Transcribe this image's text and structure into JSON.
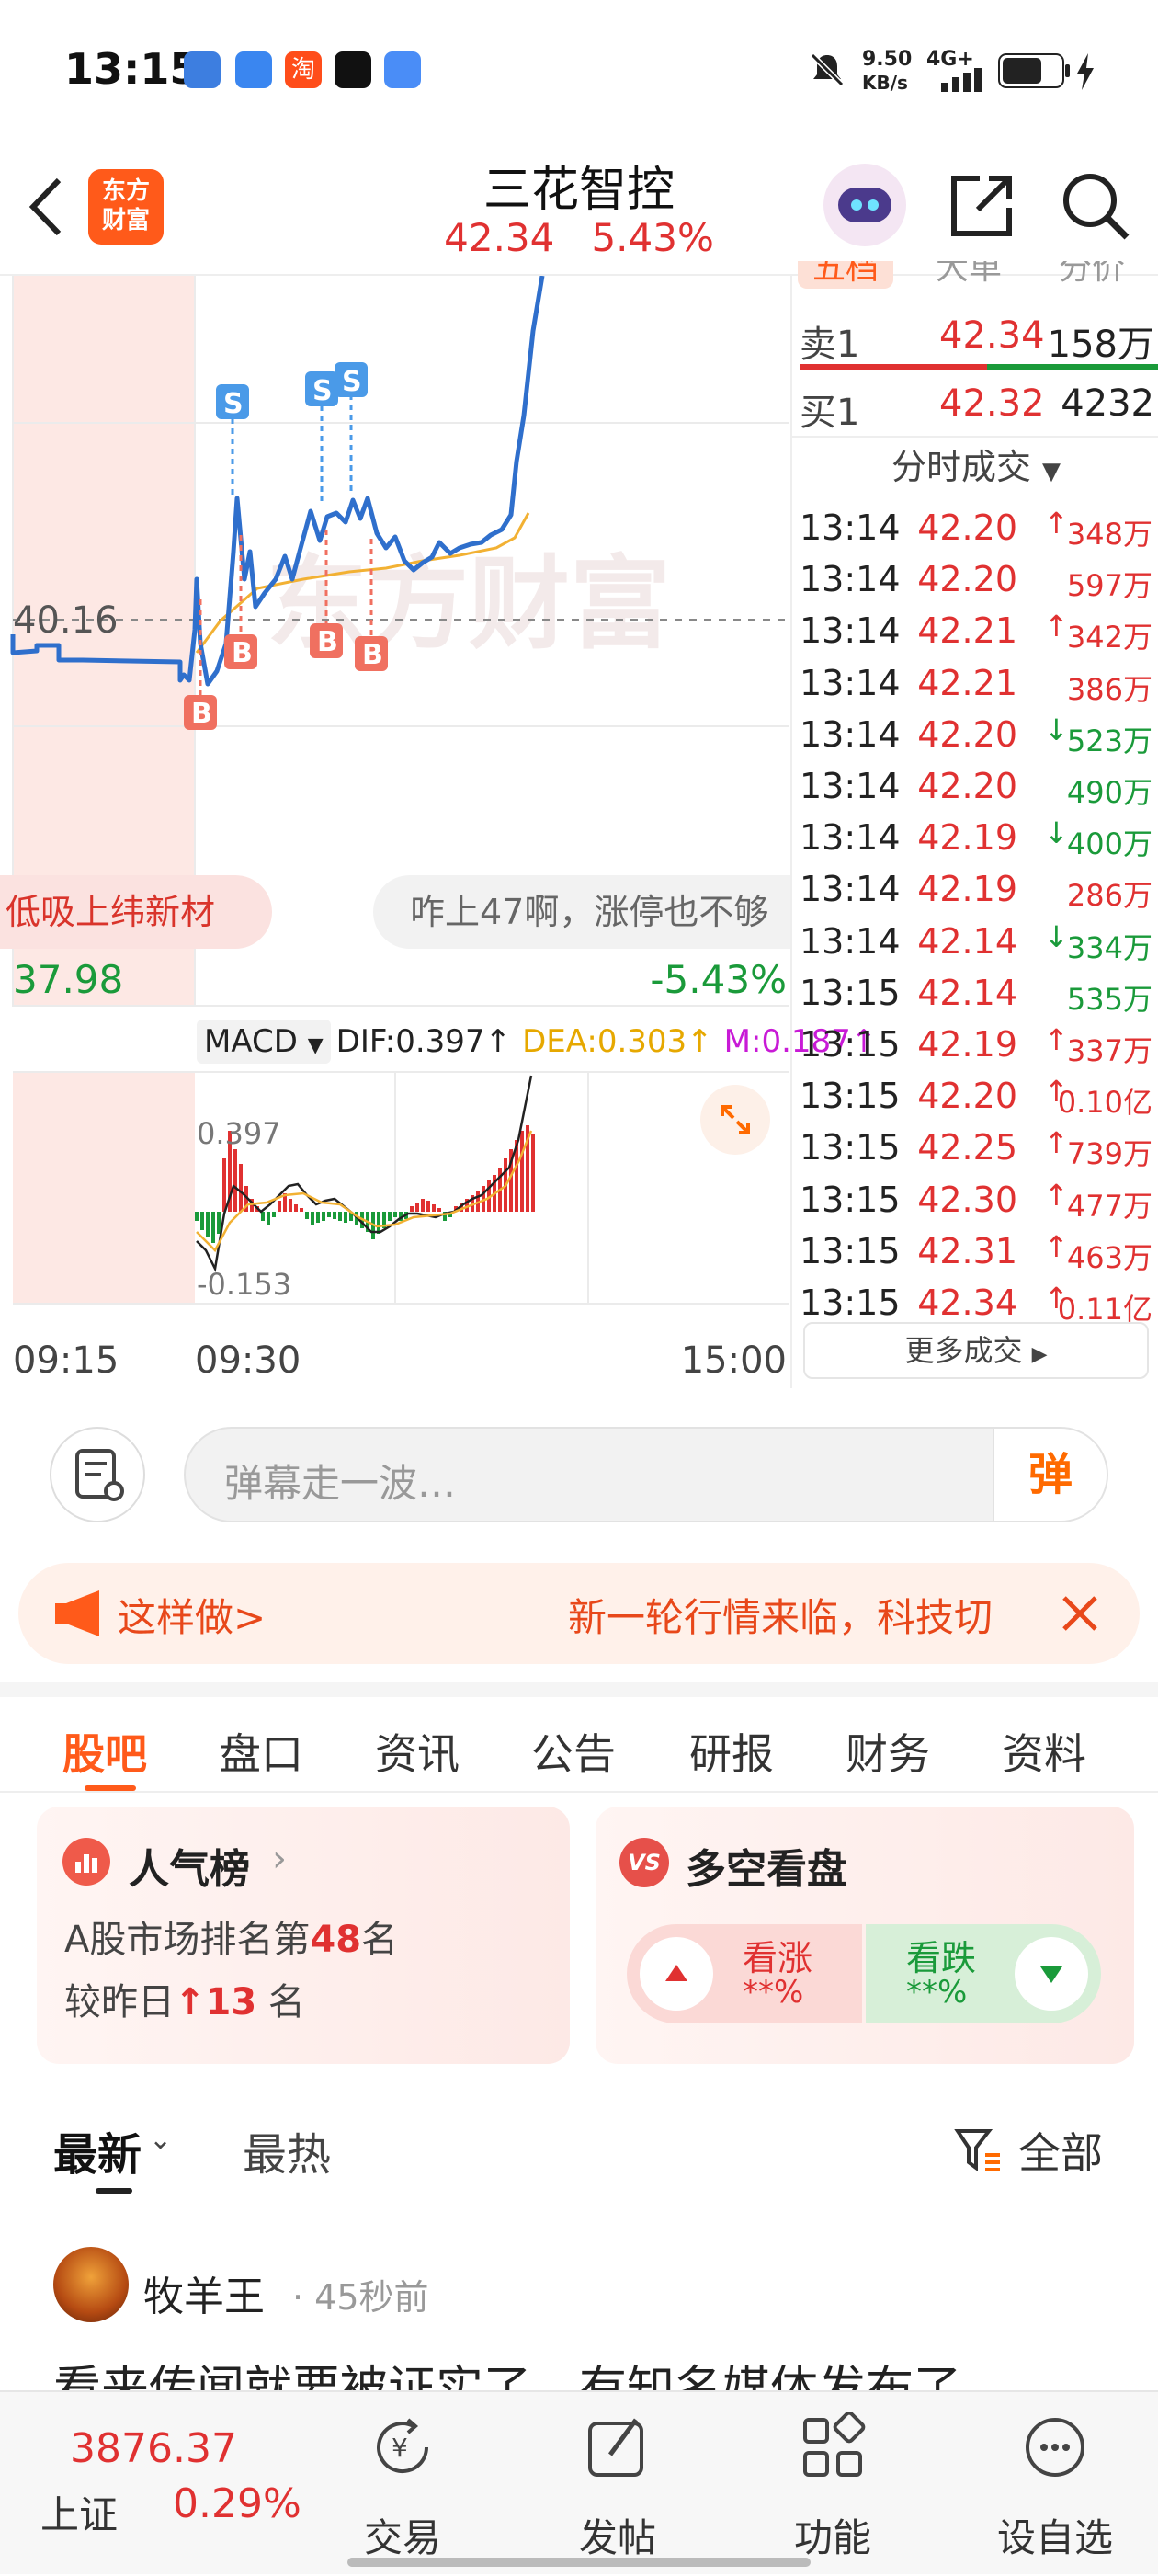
{
  "status_bar": {
    "time": "13:15",
    "net_speed": "9.50",
    "net_unit": "KB/s",
    "network": "4G+",
    "apps": [
      "mail-app-icon",
      "browser-app-icon",
      "taobao-app-icon",
      "tiktok-app-icon",
      "vivo-app-icon"
    ],
    "taobao_label": "淘"
  },
  "header": {
    "logo_line1": "东方",
    "logo_line2": "财富",
    "title": "三花智控",
    "price": "42.34",
    "change_pct": "5.43%"
  },
  "chart": {
    "ref_price": "40.16",
    "low_price": "37.98",
    "low_pct": "-5.43%",
    "watermark": "东方财富",
    "bubble_left": "低吸上纬新材",
    "bubble_right": "咋上47啊，涨停也不够",
    "markers": {
      "s": "S",
      "b": "B"
    },
    "macd_label": "MACD",
    "dif": "DIF:0.397↑",
    "dea": "DEA:0.303↑",
    "m": "M:0.187↑",
    "macd_high": "0.397",
    "macd_low": "-0.153",
    "time_start": "09:15",
    "time_open": "09:30",
    "time_end": "15:00"
  },
  "orderbook": {
    "tabs_partial": [
      "五档",
      "大单",
      "分价"
    ],
    "ask": {
      "label": "卖1",
      "price": "42.34",
      "vol": "158万"
    },
    "bid": {
      "label": "买1",
      "price": "42.32",
      "vol": "4232"
    },
    "ticks_title": "分时成交",
    "ticks": [
      {
        "time": "13:14",
        "price": "42.20",
        "dir": "↑",
        "vol": "348万",
        "color": "#e03131"
      },
      {
        "time": "13:14",
        "price": "42.20",
        "dir": "",
        "vol": "597万",
        "color": "#e03131"
      },
      {
        "time": "13:14",
        "price": "42.21",
        "dir": "↑",
        "vol": "342万",
        "color": "#e03131"
      },
      {
        "time": "13:14",
        "price": "42.21",
        "dir": "",
        "vol": "386万",
        "color": "#e03131"
      },
      {
        "time": "13:14",
        "price": "42.20",
        "dir": "↓",
        "vol": "523万",
        "color": "#1a9a3a"
      },
      {
        "time": "13:14",
        "price": "42.20",
        "dir": "",
        "vol": "490万",
        "color": "#1a9a3a"
      },
      {
        "time": "13:14",
        "price": "42.19",
        "dir": "↓",
        "vol": "400万",
        "color": "#1a9a3a"
      },
      {
        "time": "13:14",
        "price": "42.19",
        "dir": "",
        "vol": "286万",
        "color": "#e03131"
      },
      {
        "time": "13:14",
        "price": "42.14",
        "dir": "↓",
        "vol": "334万",
        "color": "#1a9a3a"
      },
      {
        "time": "13:15",
        "price": "42.14",
        "dir": "",
        "vol": "535万",
        "color": "#1a9a3a"
      },
      {
        "time": "13:15",
        "price": "42.19",
        "dir": "↑",
        "vol": "337万",
        "color": "#e03131"
      },
      {
        "time": "13:15",
        "price": "42.20",
        "dir": "↑",
        "vol": "0.10亿",
        "color": "#e03131"
      },
      {
        "time": "13:15",
        "price": "42.25",
        "dir": "↑",
        "vol": "739万",
        "color": "#e03131"
      },
      {
        "time": "13:15",
        "price": "42.30",
        "dir": "↑",
        "vol": "477万",
        "color": "#e03131"
      },
      {
        "time": "13:15",
        "price": "42.31",
        "dir": "↑",
        "vol": "463万",
        "color": "#e03131"
      },
      {
        "time": "13:15",
        "price": "42.34",
        "dir": "↑",
        "vol": "0.11亿",
        "color": "#e03131"
      }
    ],
    "more_label": "更多成交"
  },
  "danmu": {
    "placeholder": "弹幕走一波…",
    "send_label": "弹"
  },
  "ad": {
    "left_text": "这样做>",
    "right_text": "新一轮行情来临，科技切"
  },
  "tabs": [
    "股吧",
    "盘口",
    "资讯",
    "公告",
    "研报",
    "财务",
    "资料"
  ],
  "popularity": {
    "title": "人气榜",
    "rank_prefix": "A股市场排名第",
    "rank": "48",
    "rank_suffix": "名",
    "change_prefix": "较昨日",
    "change_arrow": "↑",
    "change": "13",
    "change_suffix": "名"
  },
  "bullbear": {
    "title": "多空看盘",
    "badge": "VS",
    "up_label": "看涨",
    "up_pct": "**%",
    "down_label": "看跌",
    "down_pct": "**%"
  },
  "feed": {
    "tab_latest": "最新",
    "tab_hot": "最热",
    "filter_label": "全部",
    "post_author": "牧羊王",
    "post_time": "· 45秒前",
    "post_text": "看来传闻就要被证实了，有知名媒体发布了"
  },
  "bottom_bar": {
    "index_value": "3876.37",
    "index_name": "上证",
    "index_pct": "0.29%",
    "trade": "交易",
    "post": "发帖",
    "functions": "功能",
    "watchlist": "设自选"
  },
  "colors": {
    "up": "#e03131",
    "down": "#1a9a3a",
    "accent": "#ff6a00",
    "price_line": "#2f6fcc",
    "avg_line": "#f2b133"
  }
}
